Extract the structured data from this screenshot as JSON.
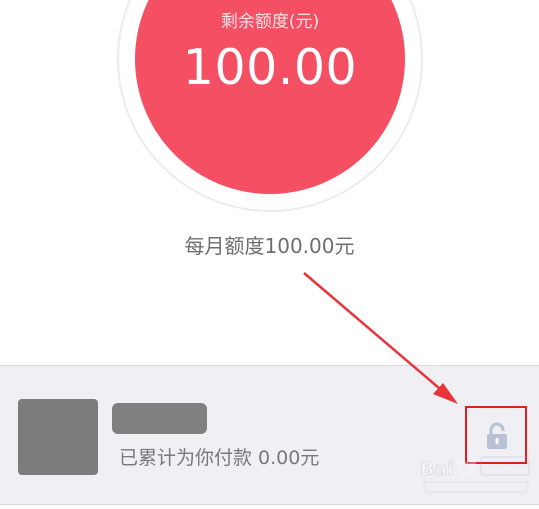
{
  "quota": {
    "remaining_label": "剩余额度(元)",
    "remaining_value": "100.00",
    "monthly_text": "每月额度100.00元"
  },
  "payer": {
    "paid_text": "已累计为你付款 0.00元"
  },
  "icons": {
    "lock": "unlock-icon"
  },
  "colors": {
    "accent": "#f44f63",
    "highlight_box": "#e02020",
    "arrow": "#e8343a",
    "lock_icon": "#b8c2d4"
  }
}
